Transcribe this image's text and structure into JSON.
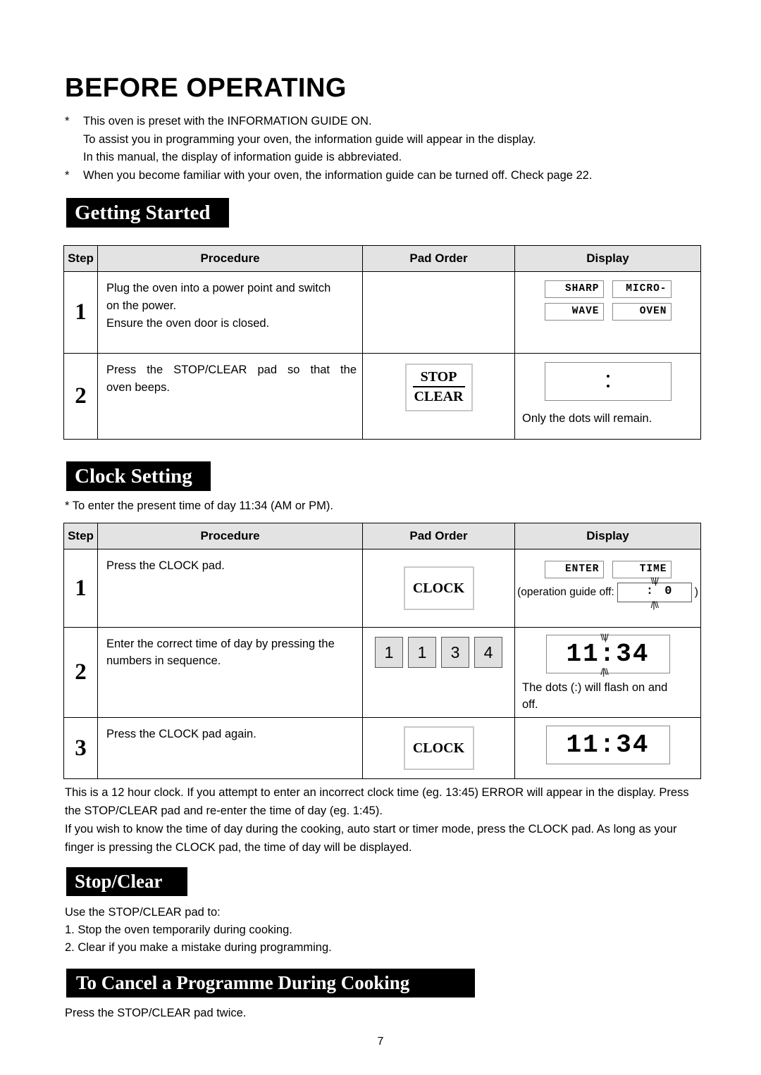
{
  "document": {
    "title": "BEFORE OPERATING",
    "page_number": "7"
  },
  "intro": {
    "bullet1_line1": "This oven is preset with the INFORMATION GUIDE ON.",
    "bullet1_line2": "To assist you in programming your oven, the information guide will appear in the display.",
    "bullet1_line3": "In this manual, the display of information guide is abbreviated.",
    "bullet2_line1": "When you become familiar with your oven, the information guide can be turned off. Check page 22.",
    "star": "*"
  },
  "sections": {
    "getting_started": {
      "banner": "Getting Started",
      "headers": {
        "step": "Step",
        "procedure": "Procedure",
        "pad_order": "Pad Order",
        "display": "Display"
      },
      "rows": [
        {
          "step": "1",
          "procedure_line1": "Plug the oven into a power point and switch",
          "procedure_line2": "on the power.",
          "procedure_line3": "Ensure the oven door is closed.",
          "pad": "",
          "display_lcd": [
            "SHARP",
            "MICRO-",
            "WAVE",
            "OVEN"
          ],
          "display_caption": ""
        },
        {
          "step": "2",
          "procedure_line1": "Press the STOP/CLEAR pad so that the",
          "procedure_line2": "oven beeps.",
          "pad_stop": "STOP",
          "pad_clear": "CLEAR",
          "display_caption": "Only the dots will remain."
        }
      ]
    },
    "clock_setting": {
      "banner": "Clock Setting",
      "note": "* To enter the present time of day 11:34 (AM or PM).",
      "headers": {
        "step": "Step",
        "procedure": "Procedure",
        "pad_order": "Pad Order",
        "display": "Display"
      },
      "rows": [
        {
          "step": "1",
          "procedure": "Press the CLOCK pad.",
          "pad": "CLOCK",
          "display_lcd": [
            "ENTER",
            "TIME"
          ],
          "guide_prefix": "(operation guide off:",
          "guide_value": ": 0",
          "guide_suffix": ")"
        },
        {
          "step": "2",
          "procedure_line1": "Enter the correct time of day by pressing the",
          "procedure_line2": "numbers in sequence.",
          "numpads": [
            "1",
            "1",
            "3",
            "4"
          ],
          "display_time": "11:34",
          "display_caption_line1": "The dots (:) will flash on and",
          "display_caption_line2": "off."
        },
        {
          "step": "3",
          "procedure": "Press the CLOCK pad again.",
          "pad": "CLOCK",
          "display_time": "11:34"
        }
      ],
      "notes": {
        "p1_line1": "This is a 12 hour clock. If you attempt to enter an incorrect clock time (eg. 13:45)  ERROR will appear in the",
        "p1_line2": "display. Press the STOP/CLEAR pad and re-enter the time of day (eg. 1:45).",
        "p2_line1": "If you wish to know the time of day during the cooking, auto start or timer mode, press the CLOCK pad. As long",
        "p2_line2": "as your finger is pressing the CLOCK pad, the time of day will be displayed."
      }
    },
    "stop_clear": {
      "banner": "Stop/Clear",
      "intro": "Use the STOP/CLEAR pad to:",
      "item1": "1. Stop the oven temporarily during cooking.",
      "item2": "2. Clear if you make a mistake during programming."
    },
    "cancel_programme": {
      "banner": "To Cancel a Programme During Cooking",
      "body": "Press the STOP/CLEAR pad twice."
    }
  },
  "flash_marks": {
    "top": "\\\\|/",
    "bottom": "/|\\\\"
  }
}
